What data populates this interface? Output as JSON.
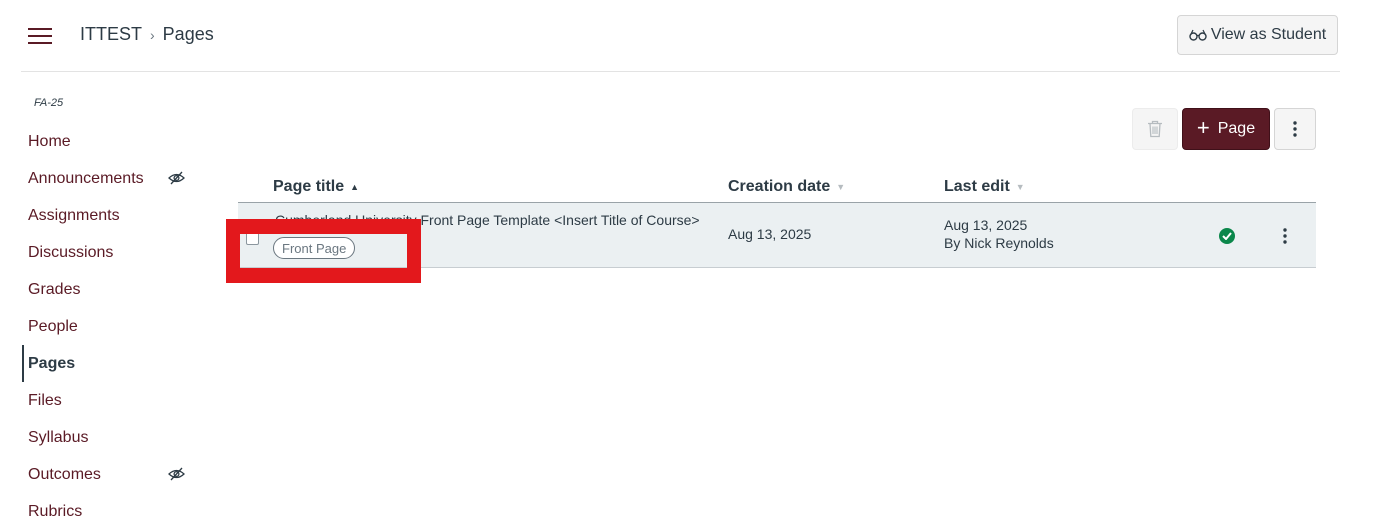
{
  "header": {
    "breadcrumb": {
      "course": "ITTEST",
      "separator": "›",
      "current": "Pages"
    },
    "view_as_student": "View as Student"
  },
  "sidebar": {
    "term": "FA-25",
    "items": [
      {
        "label": "Home",
        "hidden_icon": false,
        "active": false
      },
      {
        "label": "Announcements",
        "hidden_icon": true,
        "active": false
      },
      {
        "label": "Assignments",
        "hidden_icon": false,
        "active": false
      },
      {
        "label": "Discussions",
        "hidden_icon": false,
        "active": false
      },
      {
        "label": "Grades",
        "hidden_icon": false,
        "active": false
      },
      {
        "label": "People",
        "hidden_icon": false,
        "active": false
      },
      {
        "label": "Pages",
        "hidden_icon": false,
        "active": true
      },
      {
        "label": "Files",
        "hidden_icon": false,
        "active": false
      },
      {
        "label": "Syllabus",
        "hidden_icon": false,
        "active": false
      },
      {
        "label": "Outcomes",
        "hidden_icon": true,
        "active": false
      },
      {
        "label": "Rubrics",
        "hidden_icon": false,
        "active": false
      }
    ]
  },
  "toolbar": {
    "add_page_label": "Page",
    "add_page_icon": "plus-icon",
    "delete_icon": "trash-icon",
    "more_icon": "kebab-icon"
  },
  "table": {
    "columns": {
      "title": "Page title",
      "created": "Creation date",
      "last_edit": "Last edit"
    },
    "rows": [
      {
        "title": "Cumberland University Front Page Template <Insert Title of Course>",
        "badge": "Front Page",
        "created": "Aug 13, 2025",
        "edited_date": "Aug 13, 2025",
        "edited_by": "By Nick Reynolds",
        "published": true
      }
    ]
  },
  "colors": {
    "brand": "#5a1a25",
    "published": "#0b874b",
    "highlight": "#e3181c",
    "row_bg": "#ebf0f2"
  }
}
